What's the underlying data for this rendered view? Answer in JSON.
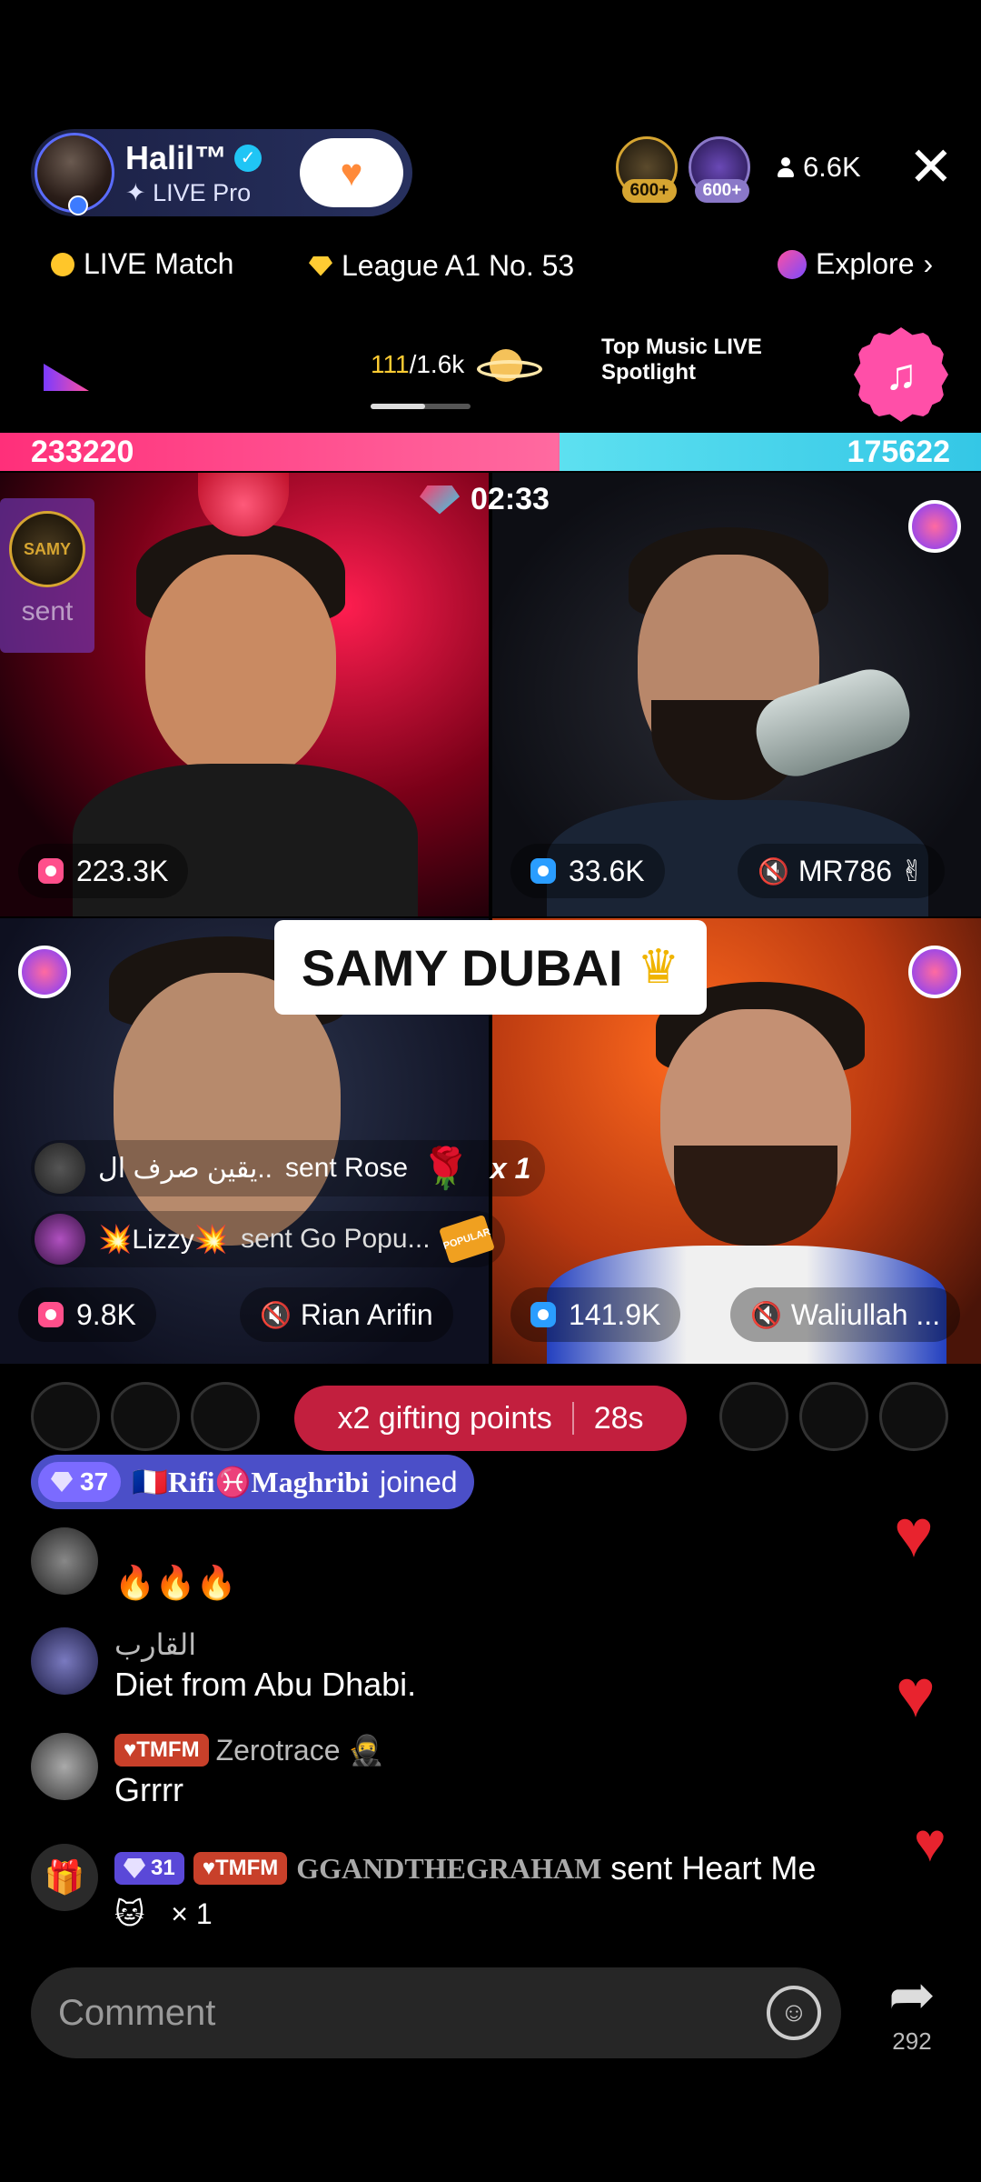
{
  "host": {
    "name": "Halil™",
    "subtitle": "✦ LIVE Pro"
  },
  "viewers": {
    "badge_1": "600+",
    "badge_2": "600+",
    "count": "6.6K"
  },
  "nav": {
    "live_match": "LIVE Match",
    "league": "League A1 No. 53",
    "explore": "Explore"
  },
  "stats": {
    "likes_current": "111",
    "likes_total": "/1.6k",
    "spotlight": "Top Music LIVE Spotlight"
  },
  "battle": {
    "left_score": "233220",
    "right_score": "175622",
    "left_share": 0.57,
    "timer": "02:33"
  },
  "sent_card": {
    "name": "SAMY",
    "label": "sent"
  },
  "cells": [
    {
      "score": "223.3K",
      "name": ""
    },
    {
      "score": "33.6K",
      "name": "MR786 ✌"
    },
    {
      "score": "9.8K",
      "name": "Rian Arifin"
    },
    {
      "score": "141.9K",
      "name": "Waliullah ..."
    }
  ],
  "banner": {
    "text": "SAMY DUBAI",
    "icon": "crown-icon"
  },
  "gifts": [
    {
      "user": "يقين صرف ال..",
      "action": "sent Rose",
      "count": "x 1"
    },
    {
      "user": "💥Lizzy💥",
      "action": "sent Go Popu..."
    }
  ],
  "gifting_points": {
    "label": "x2 gifting points",
    "time": "28s"
  },
  "joined": {
    "level": "37",
    "user": "🇫🇷Rifi♓Maghribi",
    "action": "joined"
  },
  "chat": [
    {
      "name": "",
      "message": "🔥🔥🔥"
    },
    {
      "name": "القارب",
      "message": "Diet from Abu Dhabi."
    },
    {
      "badge": "TMFM",
      "name": "Zerotrace 🥷",
      "message": "Grrrr"
    },
    {
      "level": "31",
      "badge": "TMFM",
      "name": "GGANDTHEGRAHAM",
      "message": "sent Heart Me",
      "count": "× 1"
    }
  ],
  "comment": {
    "placeholder": "Comment"
  },
  "share": {
    "count": "292"
  },
  "colors": {
    "battle_left": "#ff2f7a",
    "battle_right": "#34c7e6",
    "gifting_pill": "#c21f3e",
    "joined_pill": "#4b4fc8"
  }
}
